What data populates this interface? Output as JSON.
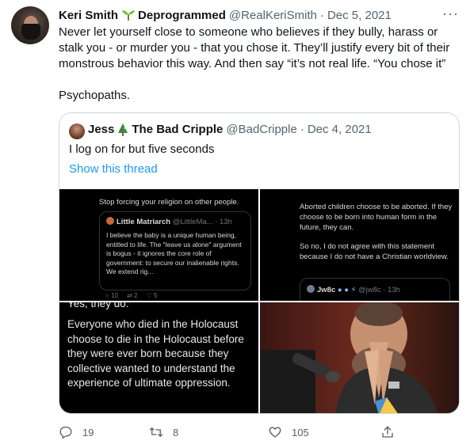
{
  "tweet": {
    "author_name": "Keri Smith",
    "author_badge_text": "Deprogrammed",
    "handle": "@RealKeriSmith",
    "separator": "·",
    "date": "Dec 5, 2021",
    "more_label": "···",
    "text_line1": "Never let yourself close to someone who believes if they bully, harass or stalk you - or murder you - that you chose it. They’ll justify every bit of their monstrous behavior this way. And then say “it’s not real life. “You chose it”",
    "text_line2": "Psychopaths."
  },
  "quote": {
    "author_name": "Jess",
    "author_suffix": "The Bad Cripple",
    "handle": "@BadCripple",
    "separator": "·",
    "date": "Dec 4, 2021",
    "text": "I log on for but five seconds",
    "thread_link": "Show this thread",
    "image1": {
      "top_text": "Stop forcing your religion on other people.",
      "card_author": "Little Matriarch",
      "card_handle": "@LittleMa... · 13h",
      "card_text": "I believe the baby is a unique human being, entitled to life. The \"leave us alone\" argument is bogus - it ignores the core role of government: to secure our inalienable rights. We extend rig...",
      "reply_count": "10",
      "retweet_count": "2",
      "like_count": "5"
    },
    "image2": {
      "text_a": "Aborted children choose to be aborted. If they choose to be born into human form in the future, they can.",
      "text_b": "So no, I do not agree with this statement because I do not have a Christian worldview.",
      "card_author": "Jw8c",
      "card_handle": "@jw8c · 13h"
    },
    "image3": {
      "cut_text": "Yes, they do.",
      "text": "Everyone who died in the Holocaust choose to die in the Holocaust before they were ever born because they collective wanted to understand the experience of ultimate oppression."
    }
  },
  "actions": {
    "reply_count": "19",
    "retweet_count": "8",
    "like_count": "105"
  },
  "colors": {
    "text": "#0f1419",
    "muted": "#536471",
    "link": "#1d9bf0",
    "border": "#cfd9de"
  }
}
